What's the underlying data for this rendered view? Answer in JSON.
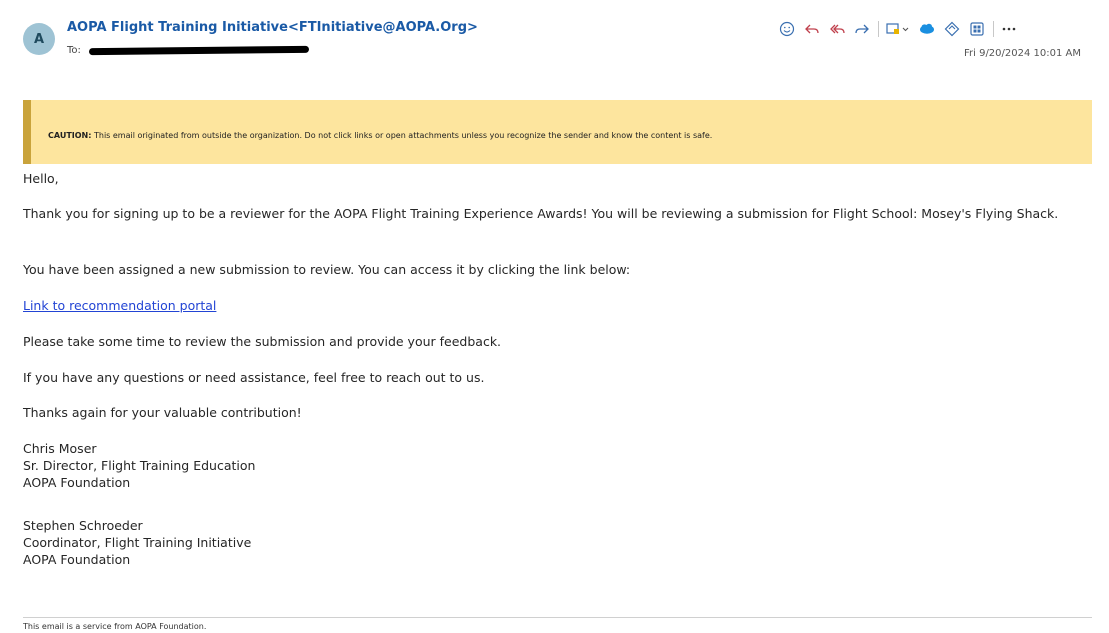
{
  "header": {
    "avatar_initial": "A",
    "sender": "AOPA Flight Training Initiative<FTInitiative@AOPA.Org>",
    "to_label": "To:",
    "timestamp": "Fri 9/20/2024 10:01 AM",
    "actions": [
      "smiley-icon",
      "reply-icon",
      "reply-all-icon",
      "forward-icon",
      "apps-icon",
      "salesforce-icon",
      "diamond-icon",
      "grid-icon",
      "more-icon"
    ]
  },
  "caution": {
    "label": "CAUTION:",
    "text": " This email originated from outside the organization. Do not click links or open attachments unless you recognize the sender and know the content is safe."
  },
  "body": {
    "greeting": "Hello,",
    "para1": "Thank you for signing up to be a reviewer for the AOPA Flight Training Experience Awards! You will be reviewing a submission for Flight School: Mosey's Flying Shack.",
    "para2": "You have been assigned a new submission to review. You can access it by clicking the link below:",
    "link": "Link to recommendation portal",
    "para3": "Please take some time to review the submission and provide your feedback.",
    "para4": "If you have any questions or need assistance, feel free to reach out to us.",
    "para5": "Thanks again for your valuable contribution!",
    "sig1": {
      "name": "Chris Moser",
      "title": "Sr. Director, Flight Training Education",
      "org": "AOPA Foundation"
    },
    "sig2": {
      "name": "Stephen Schroeder",
      "title": "Coordinator, Flight Training Initiative",
      "org": "AOPA Foundation"
    }
  },
  "footer": {
    "text": "This email is a service from AOPA Foundation."
  },
  "colors": {
    "link": "#2244d4",
    "sender": "#1a5aa6",
    "caution_bg": "#fde59e",
    "caution_border": "#c9a33b"
  }
}
